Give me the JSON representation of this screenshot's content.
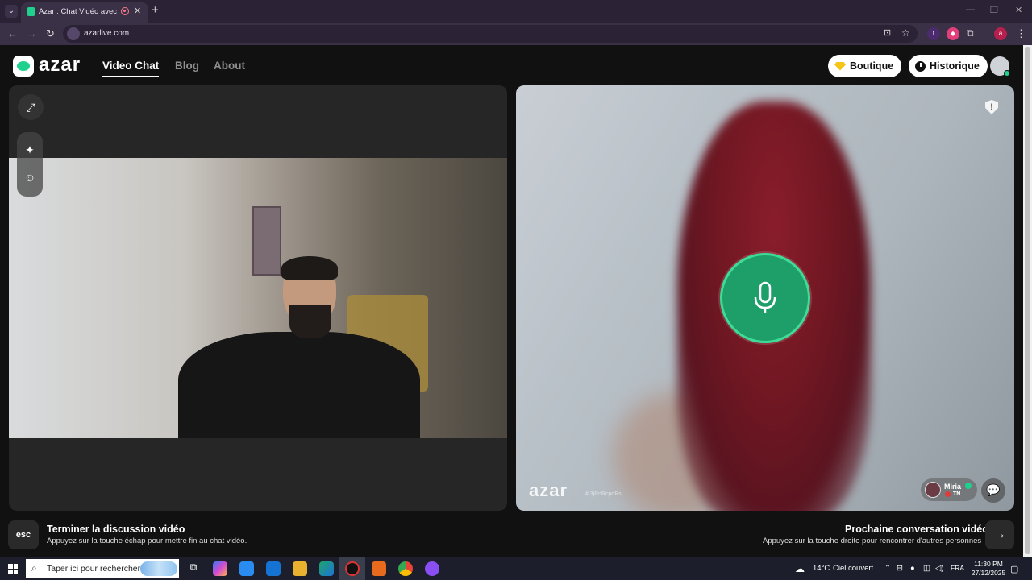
{
  "browser": {
    "tab_title": "Azar : Chat Vidéo avec de r",
    "url": "azarlive.com",
    "extensions": [
      {
        "name": "t",
        "color": "#4b2a6e"
      },
      {
        "name": "shield",
        "color": "#e23f7a"
      },
      {
        "name": "a",
        "color": "#b5204e"
      }
    ]
  },
  "app": {
    "logo_text": "azar",
    "nav": [
      "Video Chat",
      "Blog",
      "About"
    ],
    "boutique_label": "Boutique",
    "historique_label": "Historique",
    "accent_color": "#1fd08e"
  },
  "partner": {
    "name": "Miria",
    "country": "TN",
    "watermark": "azar",
    "watermark_id": "# 3jPoRcpoRs"
  },
  "footer": {
    "esc_key": "esc",
    "end_title": "Terminer la discussion vidéo",
    "end_sub": "Appuyez sur la touche échap pour mettre fin au chat vidéo.",
    "next_title": "Prochaine conversation vidéo",
    "next_sub": "Appuyez sur la touche droite pour rencontrer d'autres personnes"
  },
  "taskbar": {
    "search_placeholder": "Taper ici pour rechercher",
    "weather_temp": "14°C",
    "weather_desc": "Ciel couvert",
    "language": "FRA",
    "time": "11:30 PM",
    "date": "27/12/2025"
  }
}
